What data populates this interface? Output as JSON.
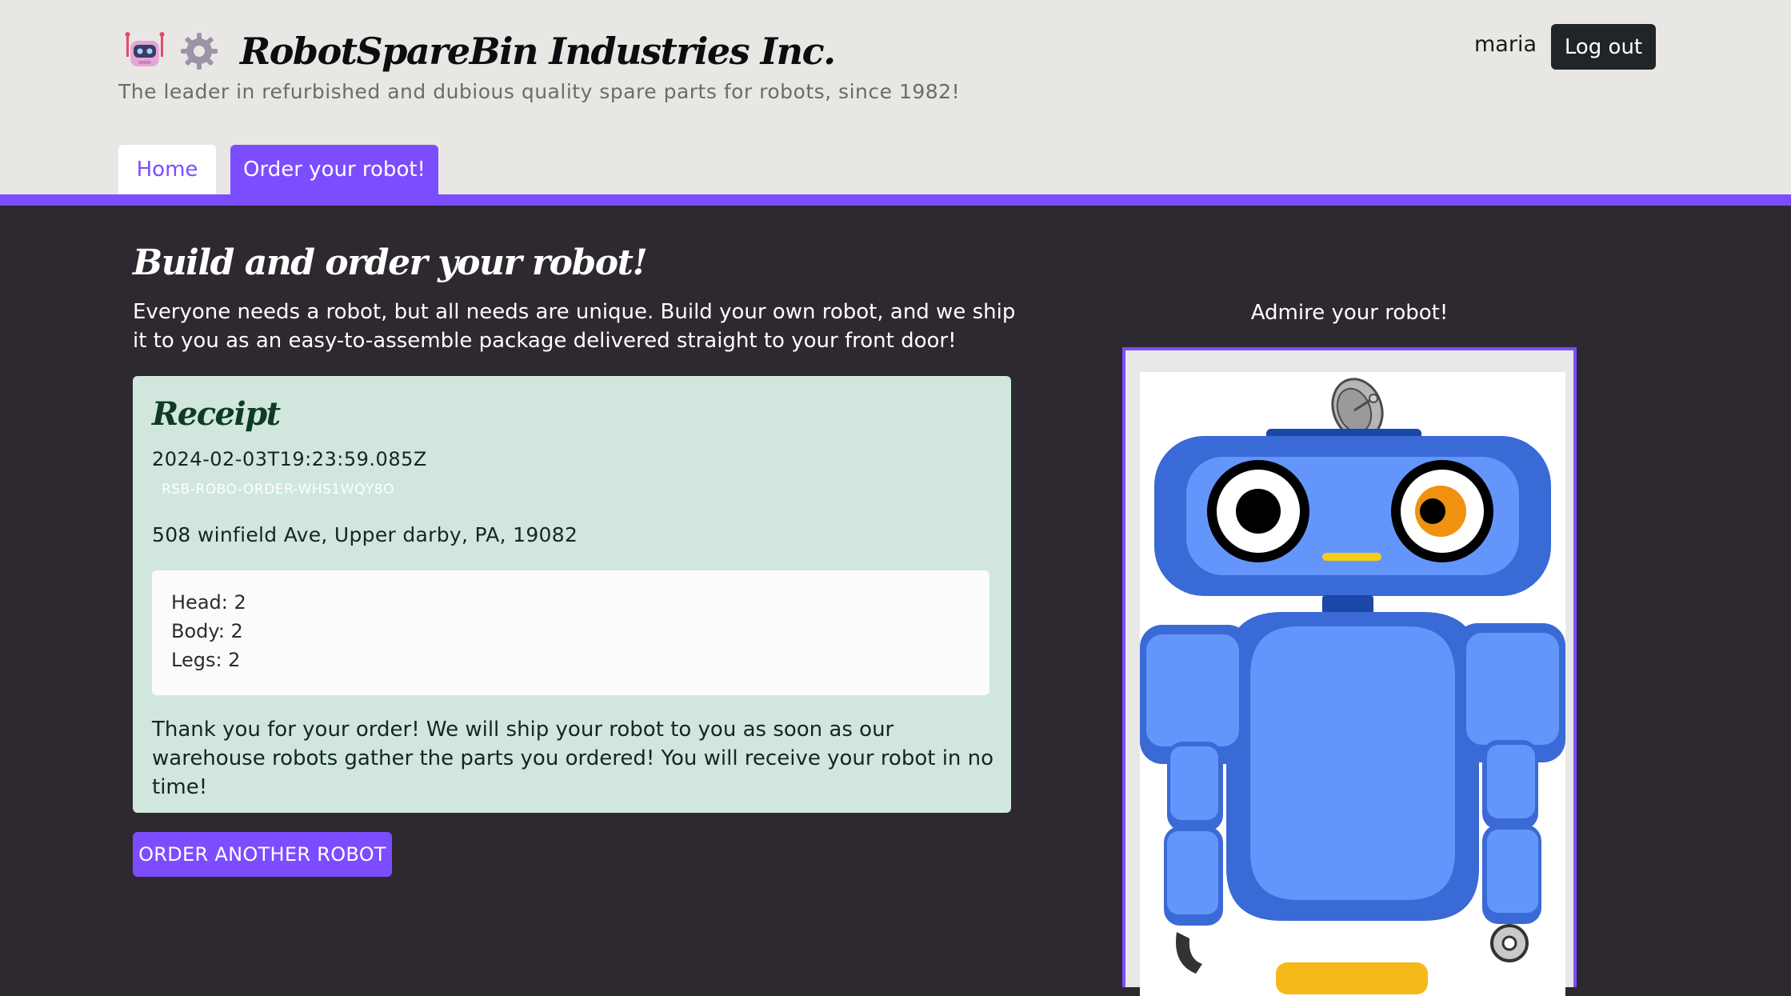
{
  "header": {
    "company_name": "RobotSpareBin Industries Inc.",
    "tagline": "The leader in refurbished and dubious quality spare parts for robots, since 1982!",
    "username": "maria",
    "logout_label": "Log out",
    "logo_icons": [
      "robot-icon",
      "gear-icon"
    ]
  },
  "nav": {
    "tabs": [
      {
        "label": "Home",
        "active": false
      },
      {
        "label": "Order your robot!",
        "active": true
      }
    ]
  },
  "main": {
    "title": "Build and order your robot!",
    "intro": "Everyone needs a robot, but all needs are unique. Build your own robot, and we ship it to you as an easy-to-assemble package delivered straight to your front door!",
    "receipt": {
      "title": "Receipt",
      "timestamp": "2024-02-03T19:23:59.085Z",
      "order_id": "RSB-ROBO-ORDER-WHS1WQY8O",
      "address": "508 winfield Ave, Upper darby, PA, 19082",
      "parts": [
        "Head: 2",
        "Body: 2",
        "Legs: 2"
      ],
      "thanks": "Thank you for your order! We will ship your robot to you as soon as our warehouse robots gather the parts you ordered! You will receive your robot in no time!"
    },
    "order_another_label": "ORDER ANOTHER ROBOT",
    "preview": {
      "label": "Admire your robot!"
    }
  },
  "theme": {
    "accent": "#7c4dff",
    "background": "#2e2830",
    "header_bg": "#e8e7e4",
    "receipt_bg": "#d1e7dd",
    "robot_blue": "#6495fb",
    "robot_dark_blue": "#3a6ad6"
  }
}
